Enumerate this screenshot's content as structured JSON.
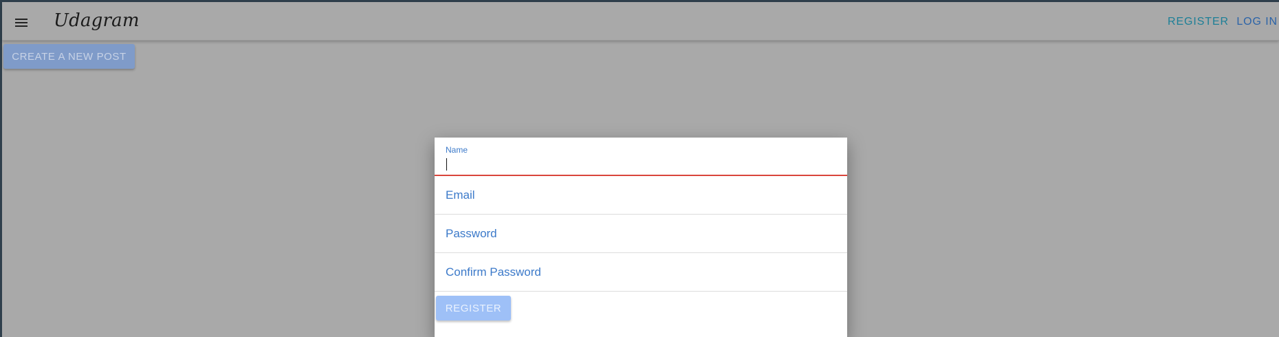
{
  "header": {
    "brand": "Udagram",
    "menu_icon": "menu-icon",
    "nav": {
      "register": "REGISTER",
      "login": "LOG IN"
    }
  },
  "main": {
    "create_post_label": "CREATE A NEW POST"
  },
  "register_dialog": {
    "name_label": "Name",
    "name_value": "",
    "email_label": "Email",
    "password_label": "Password",
    "confirm_label": "Confirm Password",
    "submit_label": "REGISTER"
  },
  "colors": {
    "backdrop": "#a9a9a9",
    "field_label": "#3b79c9",
    "focus_underline": "#d9453b",
    "primary_disabled": "#9ec0f7"
  }
}
